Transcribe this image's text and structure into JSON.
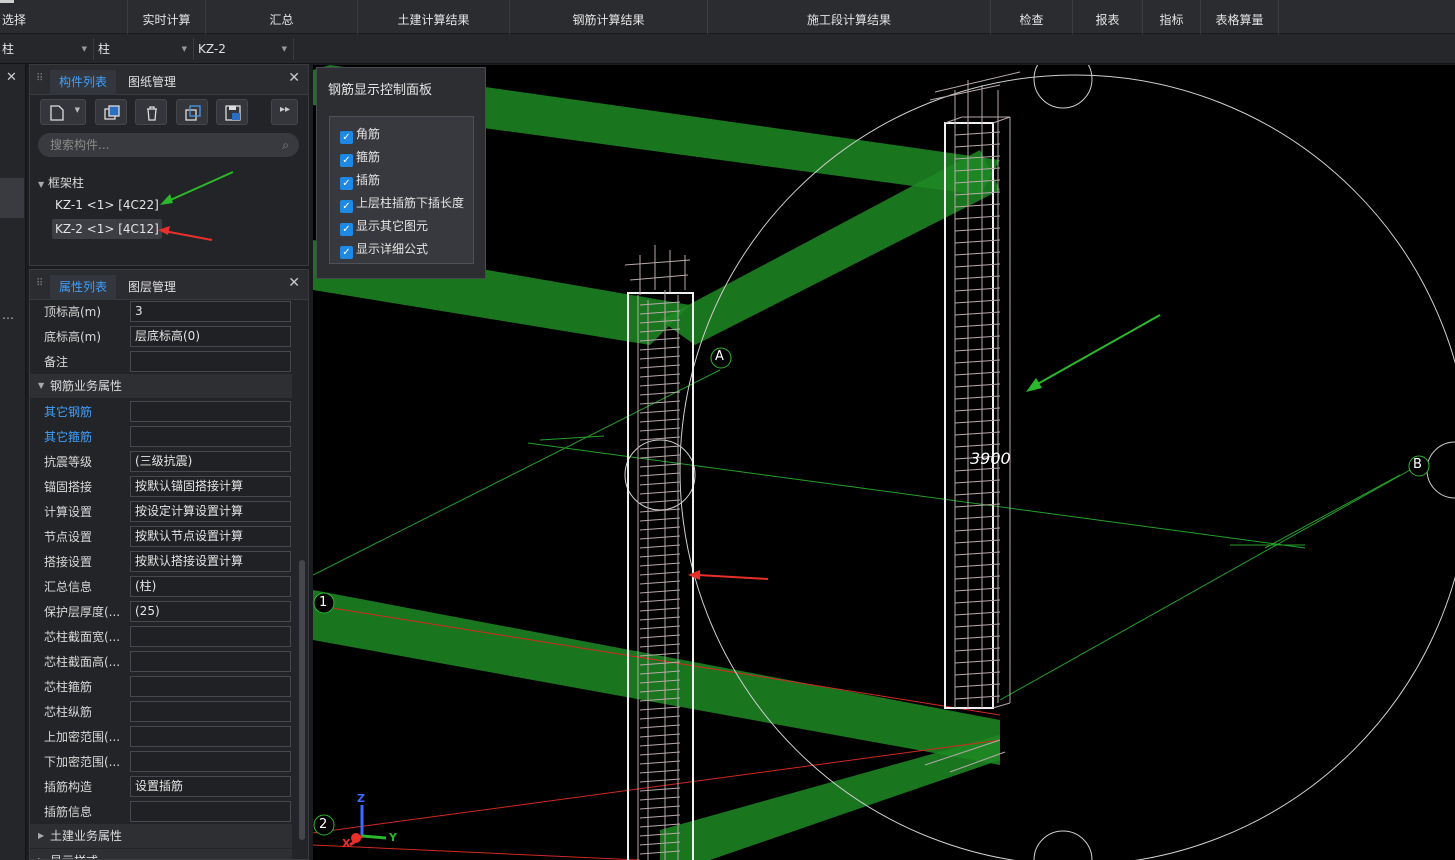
{
  "ribbon": {
    "groups": [
      "选择",
      "实时计算",
      "汇总",
      "土建计算结果",
      "钢筋计算结果",
      "施工段计算结果",
      "检查",
      "报表",
      "指标",
      "表格算量"
    ]
  },
  "filters": {
    "floor": "柱",
    "type": "柱",
    "component": "KZ-2"
  },
  "component_panel": {
    "tab_components": "构件列表",
    "tab_drawings": "图纸管理",
    "search_placeholder": "搜索构件...",
    "tree_group": "框架柱",
    "items": [
      "KZ-1 <1> [4C22]",
      "KZ-2 <1> [4C12]"
    ],
    "selected_item": "KZ-2 <1> [4C12]"
  },
  "property_panel": {
    "tab_properties": "属性列表",
    "tab_layers": "图层管理",
    "rows_top": [
      {
        "label": "顶标高(m)",
        "value": "3"
      },
      {
        "label": "底标高(m)",
        "value": "层底标高(0)"
      },
      {
        "label": "备注",
        "value": ""
      }
    ],
    "section_rebar": "钢筋业务属性",
    "rows_rebar": [
      {
        "label": "其它钢筋",
        "value": ""
      },
      {
        "label": "其它箍筋",
        "value": ""
      },
      {
        "label": "抗震等级",
        "value": "(三级抗震)"
      },
      {
        "label": "锚固搭接",
        "value": "按默认锚固搭接计算"
      },
      {
        "label": "计算设置",
        "value": "按设定计算设置计算"
      },
      {
        "label": "节点设置",
        "value": "按默认节点设置计算"
      },
      {
        "label": "搭接设置",
        "value": "按默认搭接设置计算"
      },
      {
        "label": "汇总信息",
        "value": "(柱)"
      },
      {
        "label": "保护层厚度(...",
        "value": "(25)"
      },
      {
        "label": "芯柱截面宽(...",
        "value": ""
      },
      {
        "label": "芯柱截面高(...",
        "value": ""
      },
      {
        "label": "芯柱箍筋",
        "value": ""
      },
      {
        "label": "芯柱纵筋",
        "value": ""
      },
      {
        "label": "上加密范围(...",
        "value": ""
      },
      {
        "label": "下加密范围(...",
        "value": ""
      },
      {
        "label": "插筋构造",
        "value": "设置插筋"
      },
      {
        "label": "插筋信息",
        "value": ""
      }
    ],
    "section_civil": "土建业务属性",
    "section_display": "显示样式"
  },
  "rebar_control": {
    "title": "钢筋显示控制面板",
    "options": [
      {
        "label": "角筋",
        "checked": true
      },
      {
        "label": "箍筋",
        "checked": true
      },
      {
        "label": "插筋",
        "checked": true
      },
      {
        "label": "上层柱插筋下插长度",
        "checked": true
      },
      {
        "label": "显示其它图元",
        "checked": true
      },
      {
        "label": "显示详细公式",
        "checked": true
      }
    ]
  },
  "viewport": {
    "axis_labels": [
      "A",
      "B",
      "1",
      "2"
    ],
    "dimension": "3900",
    "axis_x": "X",
    "axis_y": "Y",
    "axis_z": "Z",
    "colors": {
      "beam": "#1f8a24",
      "grid": "#23a12a",
      "rebar": "#b8a9a9",
      "arrow_green": "#2bb82b",
      "arrow_red": "#e8302a"
    }
  }
}
